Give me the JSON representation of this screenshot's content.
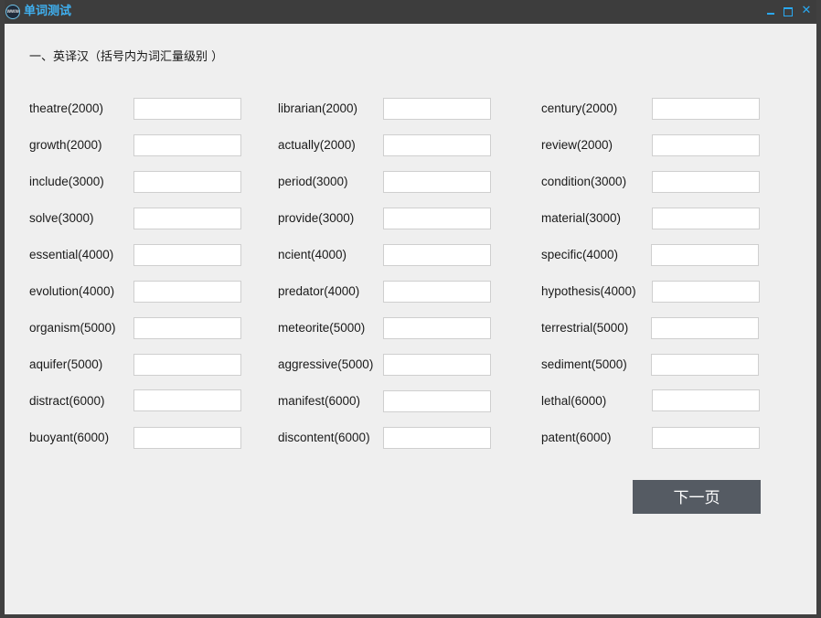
{
  "window": {
    "title": "单词测试",
    "icon_label": "www",
    "controls": {
      "minimize": "minimize-icon",
      "maximize": "maximize-icon",
      "close": "✕"
    }
  },
  "section": {
    "title": "一、英译汉（括号内为词汇量级别 ）"
  },
  "words": {
    "col1": [
      {
        "label": "theatre(2000)",
        "value": ""
      },
      {
        "label": "growth(2000)",
        "value": ""
      },
      {
        "label": "include(3000)",
        "value": ""
      },
      {
        "label": "solve(3000)",
        "value": ""
      },
      {
        "label": "essential(4000)",
        "value": ""
      },
      {
        "label": "evolution(4000)",
        "value": ""
      },
      {
        "label": "organism(5000)",
        "value": ""
      },
      {
        "label": "aquifer(5000)",
        "value": ""
      },
      {
        "label": "distract(6000)",
        "value": ""
      },
      {
        "label": "buoyant(6000)",
        "value": ""
      }
    ],
    "col2": [
      {
        "label": "librarian(2000)",
        "value": ""
      },
      {
        "label": "actually(2000)",
        "value": ""
      },
      {
        "label": "period(3000)",
        "value": ""
      },
      {
        "label": "provide(3000)",
        "value": ""
      },
      {
        "label": "ncient(4000)",
        "value": ""
      },
      {
        "label": "predator(4000)",
        "value": ""
      },
      {
        "label": "meteorite(5000)",
        "value": ""
      },
      {
        "label": "aggressive(5000)",
        "value": ""
      },
      {
        "label": "manifest(6000)",
        "value": ""
      },
      {
        "label": "discontent(6000)",
        "value": ""
      }
    ],
    "col3": [
      {
        "label": "century(2000)",
        "value": ""
      },
      {
        "label": "review(2000)",
        "value": ""
      },
      {
        "label": "condition(3000)",
        "value": ""
      },
      {
        "label": "material(3000)",
        "value": ""
      },
      {
        "label": "specific(4000)",
        "value": ""
      },
      {
        "label": "hypothesis(4000)",
        "value": ""
      },
      {
        "label": "terrestrial(5000)",
        "value": ""
      },
      {
        "label": "sediment(5000)",
        "value": ""
      },
      {
        "label": "lethal(6000)",
        "value": ""
      },
      {
        "label": "patent(6000)",
        "value": ""
      }
    ]
  },
  "actions": {
    "next_label": "下一页"
  },
  "colors": {
    "titlebar_bg": "#3d3d3d",
    "title_text": "#3fb0f0",
    "content_bg": "#efefef",
    "button_bg": "#555b63",
    "button_text": "#ffffff"
  }
}
